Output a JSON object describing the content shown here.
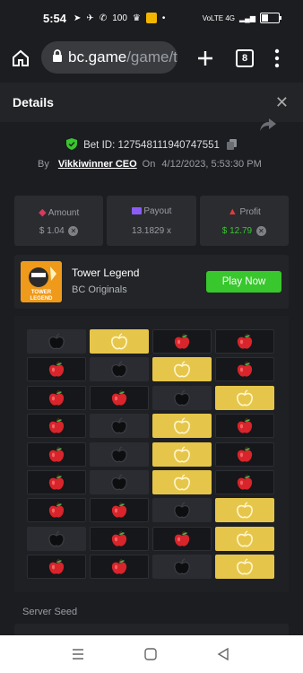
{
  "status": {
    "time": "5:54",
    "signal": "VoLTE 4G",
    "notif_count": "100"
  },
  "browser": {
    "domain": "bc.game",
    "path": "/game/t",
    "tab_count": "8"
  },
  "details": {
    "title": "Details"
  },
  "bet": {
    "label": "Bet ID:",
    "id": "127548111940747551",
    "by": "By",
    "user": "Vikkiwinner CEO",
    "on": "On",
    "datetime": "4/12/2023, 5:53:30 PM"
  },
  "stats": {
    "amount_label": "Amount",
    "amount_value": "$ 1.04",
    "payout_label": "Payout",
    "payout_value": "13.1829 x",
    "profit_label": "Profit",
    "profit_value": "$ 12.79"
  },
  "game": {
    "name": "Tower Legend",
    "provider": "BC Originals",
    "play": "Play Now",
    "thumb_text": "TOWER LEGEND"
  },
  "board": [
    [
      "bomb",
      "gold",
      "apple",
      "apple"
    ],
    [
      "apple",
      "bomb",
      "gold",
      "apple"
    ],
    [
      "apple",
      "apple",
      "bomb",
      "gold"
    ],
    [
      "apple",
      "bomb",
      "gold",
      "apple"
    ],
    [
      "apple",
      "bomb",
      "gold",
      "apple"
    ],
    [
      "apple",
      "bomb",
      "gold",
      "apple"
    ],
    [
      "apple",
      "apple",
      "bomb",
      "gold"
    ],
    [
      "bomb",
      "apple",
      "apple",
      "gold"
    ],
    [
      "apple",
      "apple",
      "bomb",
      "gold"
    ]
  ],
  "server_seed_label": "Server Seed",
  "colors": {
    "accent_green": "#38c72d",
    "gold": "#e6c64a",
    "apple_red": "#d8242b"
  }
}
